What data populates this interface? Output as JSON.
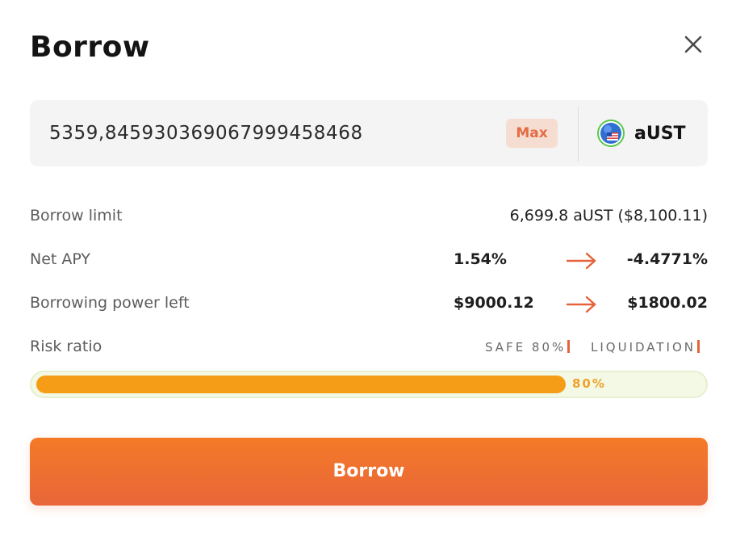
{
  "modal": {
    "title": "Borrow"
  },
  "amount": {
    "value": "5359,845930369067999458468",
    "max_label": "Max",
    "token": "aUST"
  },
  "rows": {
    "borrow_limit": {
      "label": "Borrow limit",
      "value": "6,699.8 aUST ($8,100.11)"
    },
    "net_apy": {
      "label": "Net APY",
      "from": "1.54%",
      "to": "-4.4771%"
    },
    "borrowing_power": {
      "label": "Borrowing power left",
      "from": "$9000.12",
      "to": "$1800.02"
    },
    "risk_ratio": {
      "label": "Risk ratio",
      "safe_marker": "SAFE 80%",
      "liquidation_marker": "LIQUIDATION",
      "progress_label": "80%",
      "progress_fraction": 0.8
    }
  },
  "actions": {
    "borrow_label": "Borrow"
  },
  "colors": {
    "accent": "#e9663a",
    "progress": "#f59d17",
    "progress_track": "#f3f9e4",
    "max_bg": "#f6ddd1"
  },
  "icons": {
    "close": "close-icon",
    "token": "aust-token-icon",
    "arrow": "arrow-right-icon"
  }
}
